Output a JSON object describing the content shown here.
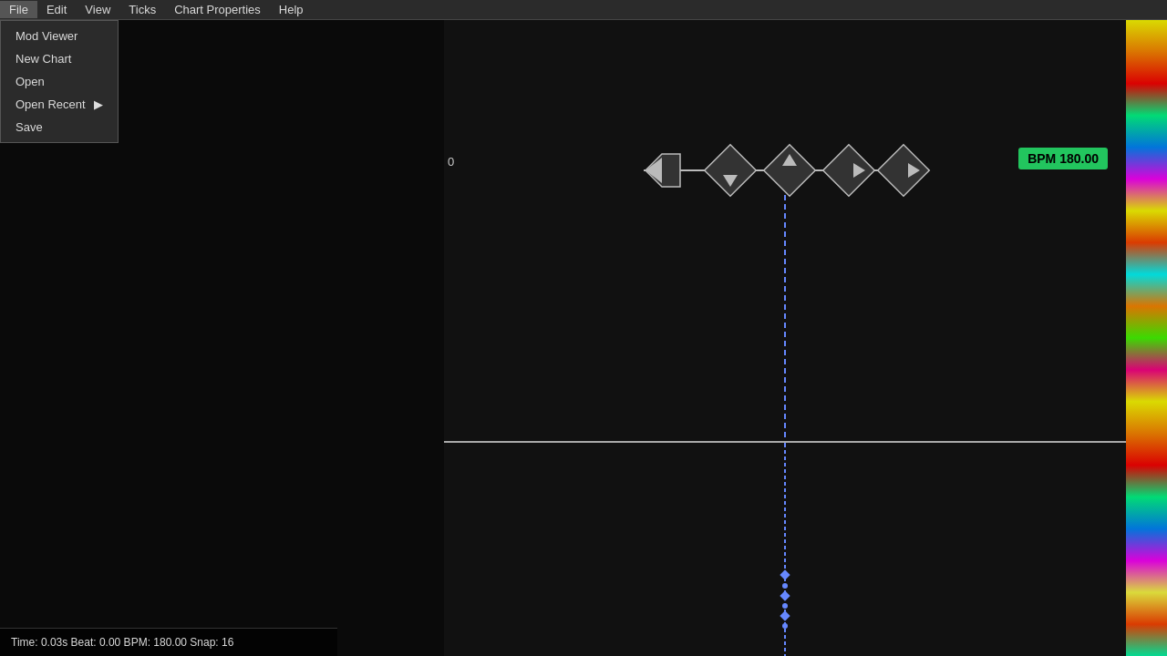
{
  "menubar": {
    "items": [
      "File",
      "Edit",
      "View",
      "Ticks",
      "Chart Properties",
      "Help"
    ]
  },
  "file_dropdown": {
    "items": [
      {
        "label": "Mod Viewer",
        "has_submenu": false
      },
      {
        "label": "New Chart",
        "has_submenu": false
      },
      {
        "label": "Open",
        "has_submenu": false
      },
      {
        "label": "Open Recent",
        "has_submenu": true
      },
      {
        "label": "Save",
        "has_submenu": false
      }
    ]
  },
  "bpm": {
    "label": "BPM 180.00"
  },
  "zero_label": "0",
  "statusbar": {
    "text": "Time: 0.03s Beat: 0.00 BPM: 180.00 Snap: 16"
  }
}
